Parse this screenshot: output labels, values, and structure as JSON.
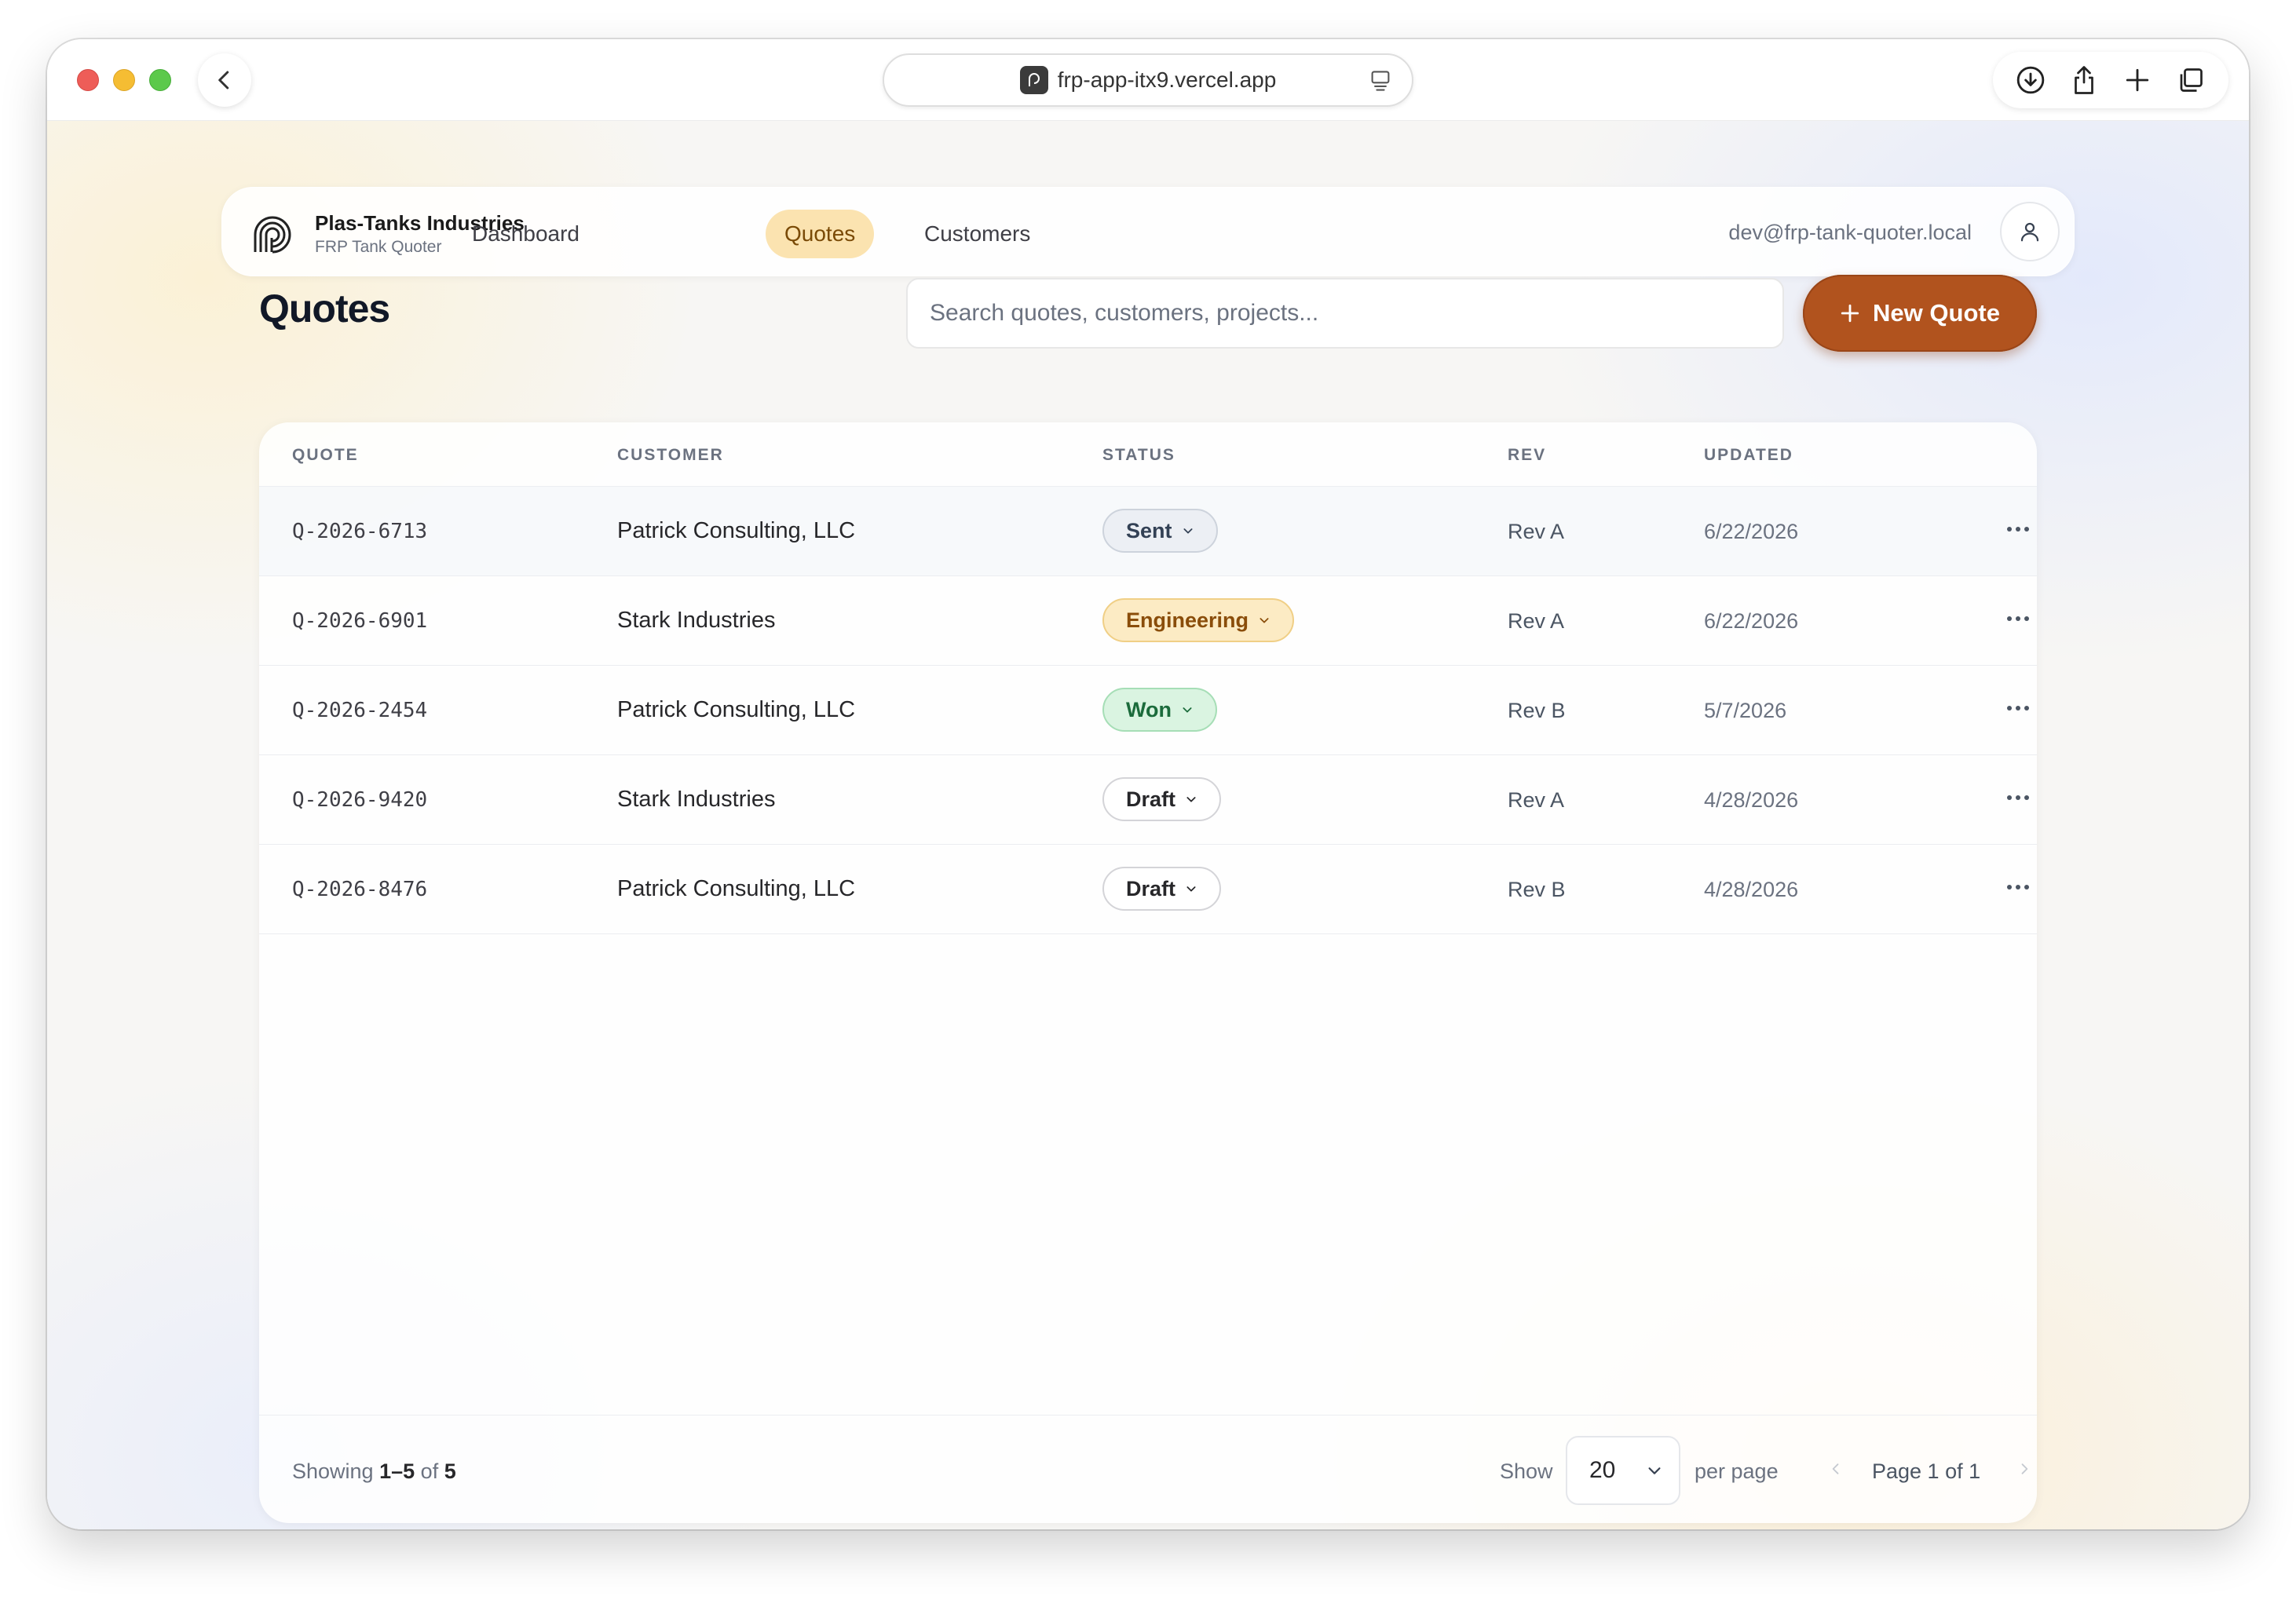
{
  "browser": {
    "url": "frp-app-itx9.vercel.app"
  },
  "nav": {
    "brand_name": "Plas-Tanks Industries",
    "brand_sub": "FRP Tank Quoter",
    "links": [
      "Dashboard",
      "Quotes",
      "Customers"
    ],
    "active_link": "Quotes",
    "user_email": "dev@frp-tank-quoter.local"
  },
  "page": {
    "title": "Quotes",
    "search_placeholder": "Search quotes, customers, projects...",
    "new_quote_label": "New Quote"
  },
  "table": {
    "columns": [
      "QUOTE",
      "CUSTOMER",
      "STATUS",
      "REV",
      "UPDATED"
    ],
    "rows": [
      {
        "quote": "Q-2026-6713",
        "customer": "Patrick Consulting, LLC",
        "status": "Sent",
        "rev": "Rev A",
        "updated": "6/22/2026"
      },
      {
        "quote": "Q-2026-6901",
        "customer": "Stark Industries",
        "status": "Engineering",
        "rev": "Rev A",
        "updated": "6/22/2026"
      },
      {
        "quote": "Q-2026-2454",
        "customer": "Patrick Consulting, LLC",
        "status": "Won",
        "rev": "Rev B",
        "updated": "5/7/2026"
      },
      {
        "quote": "Q-2026-9420",
        "customer": "Stark Industries",
        "status": "Draft",
        "rev": "Rev A",
        "updated": "4/28/2026"
      },
      {
        "quote": "Q-2026-8476",
        "customer": "Patrick Consulting, LLC",
        "status": "Draft",
        "rev": "Rev B",
        "updated": "4/28/2026"
      }
    ]
  },
  "footer": {
    "showing_prefix": "Showing",
    "showing_range": "1–5",
    "showing_of": "of",
    "showing_total": "5",
    "show_label": "Show",
    "per_page_value": "20",
    "per_page_label": "per page",
    "page_text": "Page 1 of 1"
  },
  "colors": {
    "accent": "#b1531e",
    "active_nav_bg": "#fbe3b0"
  },
  "icons": {
    "back": "chevron-left-icon",
    "downloads": "download-icon",
    "share": "share-icon",
    "new_tab": "plus-icon",
    "tabs": "tabs-overview-icon",
    "avatar": "user-icon",
    "row_menu": "more-horizontal-icon"
  }
}
